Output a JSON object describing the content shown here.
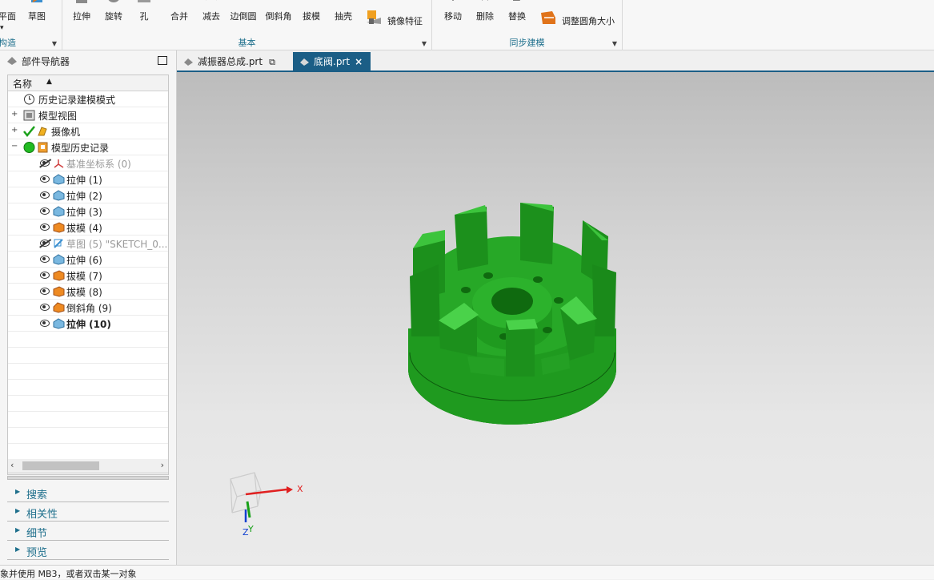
{
  "ribbon": {
    "construct": {
      "plane_label": "平面",
      "sketch_label": "草图",
      "group_title": "构造"
    },
    "basic": {
      "extrude_label": "拉伸",
      "revolve_label": "旋转",
      "hole_label": "孔",
      "unite_label": "合并",
      "subtract_label": "减去",
      "edge_blend_label": "边倒圆",
      "chamfer_label": "倒斜角",
      "draft_label": "拔模",
      "shell_label": "抽壳",
      "mirror_feature_label": "镜像特征",
      "group_title": "基本"
    },
    "sync": {
      "move_label": "移动",
      "delete_label": "删除",
      "replace_label": "替换",
      "resize_blend_label": "调整圆角大小",
      "group_title": "同步建模"
    }
  },
  "navigator": {
    "title": "部件导航器",
    "column_name": "名称",
    "tree": [
      {
        "label": "历史记录建模模式",
        "icon": "clock-icon"
      },
      {
        "label": "模型视图",
        "icon": "model-view-icon",
        "expander": "+"
      },
      {
        "label": "摄像机",
        "icon": "camera-icon",
        "expander": "+"
      },
      {
        "label": "模型历史记录",
        "icon": "history-icon",
        "expander": "−"
      },
      {
        "label": "基准坐标系 (0)",
        "icon": "datum-csys-icon",
        "hidden": true
      },
      {
        "label": "拉伸 (1)",
        "icon": "extrude-icon"
      },
      {
        "label": "拉伸 (2)",
        "icon": "extrude-icon"
      },
      {
        "label": "拉伸 (3)",
        "icon": "extrude-icon"
      },
      {
        "label": "拔模 (4)",
        "icon": "draft-icon"
      },
      {
        "label": "草图 (5) \"SKETCH_0...",
        "icon": "sketch-icon",
        "hidden": true
      },
      {
        "label": "拉伸 (6)",
        "icon": "extrude-icon"
      },
      {
        "label": "拔模 (7)",
        "icon": "draft-icon"
      },
      {
        "label": "拔模 (8)",
        "icon": "draft-icon"
      },
      {
        "label": "倒斜角 (9)",
        "icon": "chamfer-icon"
      },
      {
        "label": "拉伸 (10)",
        "icon": "extrude-icon",
        "current": true
      }
    ],
    "panels": [
      "搜索",
      "相关性",
      "细节",
      "预览"
    ]
  },
  "tabs": [
    {
      "label": "减振器总成.prt"
    },
    {
      "label": "底阀.prt",
      "active": true,
      "close": "×"
    }
  ],
  "viewport": {
    "triad": {
      "x_label": "X",
      "y_label": "Y",
      "z_label": "Z"
    },
    "colors": {
      "model": "#1f9a1f",
      "x_axis": "#e02020",
      "y_axis": "#18a018",
      "z_axis": "#1040d0"
    }
  },
  "status": {
    "text": "象并使用 MB3，或者双击某一对象"
  }
}
